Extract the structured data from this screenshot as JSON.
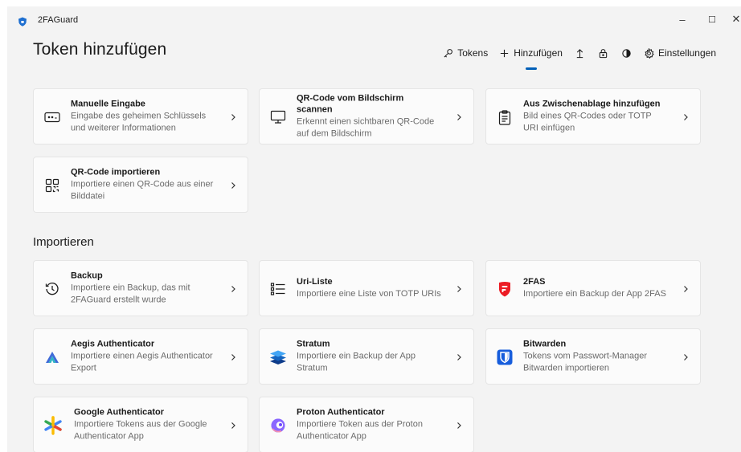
{
  "app": {
    "title": "2FAGuard"
  },
  "window_controls": {
    "minimize": "–",
    "maximize": "☐",
    "close": "✕"
  },
  "page_title": "Token hinzufügen",
  "nav": {
    "tokens": "Tokens",
    "add": "Hinzufügen",
    "settings": "Einstellungen",
    "icons": [
      "key-icon",
      "plus-icon",
      "upload-icon",
      "lock-icon",
      "contrast-icon",
      "gear-icon"
    ]
  },
  "accent_color": "#005fb8",
  "add_cards": [
    {
      "title": "Manuelle Eingabe",
      "desc": "Eingabe des geheimen Schlüssels und weiterer Informationen",
      "icon": "keyboard-icon"
    },
    {
      "title": "QR-Code vom Bildschirm scannen",
      "desc": "Erkennt einen sichtbaren QR-Code auf dem Bildschirm",
      "icon": "monitor-icon"
    },
    {
      "title": "Aus Zwischenablage hinzufügen",
      "desc": "Bild eines QR-Codes oder TOTP URI einfügen",
      "icon": "clipboard-icon"
    },
    {
      "title": "QR-Code importieren",
      "desc": "Importiere einen QR-Code aus einer Bilddatei",
      "icon": "qr-code-icon"
    }
  ],
  "import_heading": "Importieren",
  "import_cards": [
    {
      "title": "Backup",
      "desc": "Importiere ein Backup, das mit 2FAGuard erstellt wurde",
      "icon": "history-icon"
    },
    {
      "title": "Uri-Liste",
      "desc": "Importiere eine Liste von TOTP URIs",
      "icon": "list-icon"
    },
    {
      "title": "2FAS",
      "desc": "Importiere ein Backup der App 2FAS",
      "icon": "2fas-logo-icon"
    },
    {
      "title": "Aegis Authenticator",
      "desc": "Importiere einen Aegis Authenticator Export",
      "icon": "aegis-logo-icon"
    },
    {
      "title": "Stratum",
      "desc": "Importiere ein Backup der App Stratum",
      "icon": "stratum-logo-icon"
    },
    {
      "title": "Bitwarden",
      "desc": "Tokens vom Passwort-Manager Bitwarden importieren",
      "icon": "bitwarden-logo-icon"
    },
    {
      "title": "Google Authenticator",
      "desc": "Importiere Tokens aus der Google Authenticator App",
      "icon": "google-authenticator-logo-icon"
    },
    {
      "title": "Proton Authenticator",
      "desc": "Importiere Token aus der Proton Authenticator App",
      "icon": "proton-logo-icon"
    }
  ]
}
